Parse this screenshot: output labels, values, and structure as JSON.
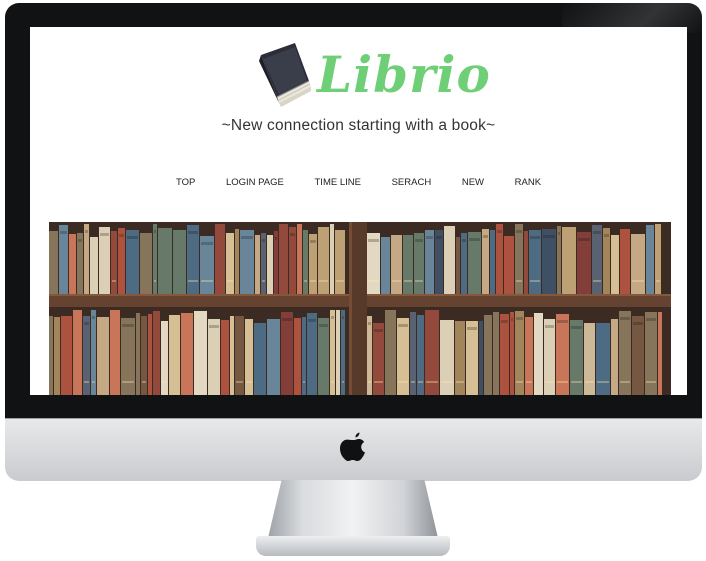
{
  "site": {
    "brand": "Librio",
    "tagline": "~New connection starting with a book~",
    "nav": [
      "TOP",
      "LOGIN PAGE",
      "TIME LINE",
      "SERACH",
      "NEW",
      "RANK"
    ]
  },
  "icons": [
    "book-logo-icon",
    "apple-logo-icon"
  ],
  "colors": {
    "brand": "#6fcf76",
    "bezel": "#111214",
    "shelf_wood": "#5a3420"
  }
}
